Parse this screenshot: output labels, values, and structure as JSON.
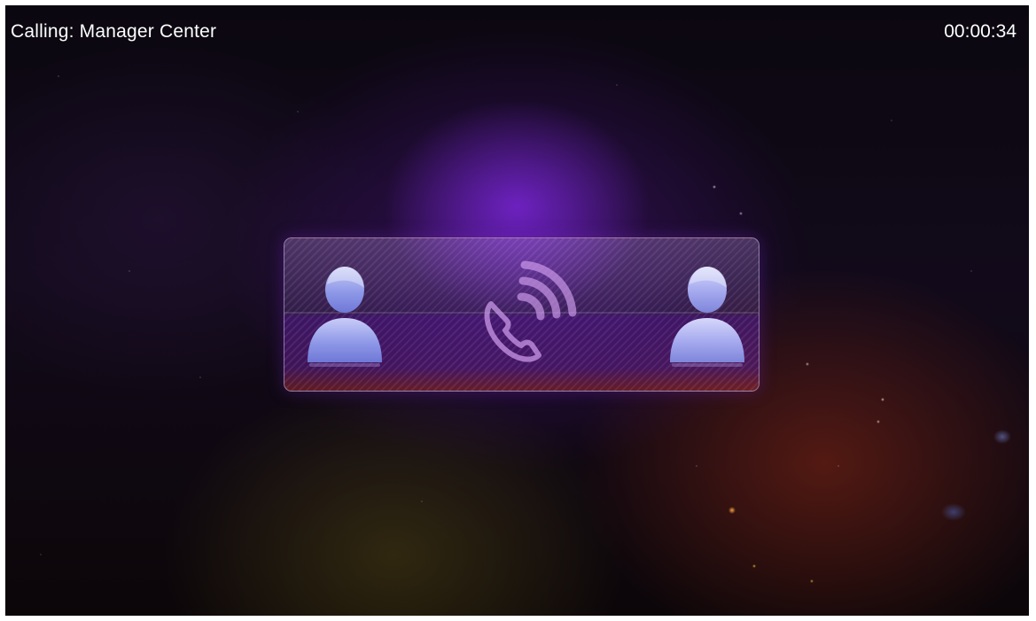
{
  "call": {
    "title": "Calling: Manager Center",
    "duration": "00:00:34"
  },
  "icons": {
    "caller": "person-icon",
    "callee": "person-icon",
    "call_status": "phone-ringing-icon"
  },
  "colors": {
    "text": "#ffffff",
    "accent": "#8c2cf0",
    "panel_border": "#c8bee6",
    "person_fill": "#8f99e8"
  }
}
